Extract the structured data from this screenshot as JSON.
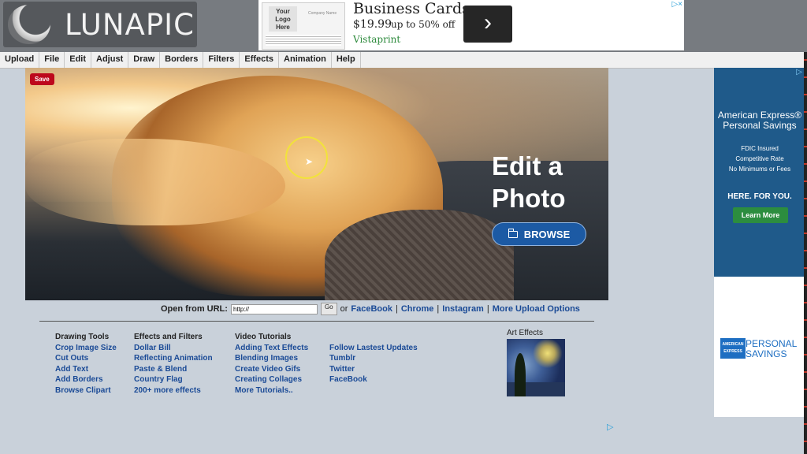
{
  "logo": {
    "text": "LUNAPIC"
  },
  "top_ad": {
    "card_logo": "Your Logo Here",
    "card_name": "Company Name",
    "headline": "Business Cards",
    "price": "$19.99",
    "offer": "up to 50% off",
    "brand": "Vistaprint",
    "arrow": "›",
    "choice_icon": "▷×"
  },
  "menu": [
    "Upload",
    "File",
    "Edit",
    "Adjust",
    "Draw",
    "Borders",
    "Filters",
    "Effects",
    "Animation",
    "Help"
  ],
  "hero": {
    "save_label": "Save",
    "title_line1": "Edit a",
    "title_line2": "Photo",
    "browse_label": "BROWSE"
  },
  "url_row": {
    "label": "Open from URL:",
    "input_value": "http://",
    "go": "Go",
    "or_text": "or",
    "sep": "|",
    "links": [
      "FaceBook",
      "Chrome",
      "Instagram",
      "More Upload Options"
    ]
  },
  "columns": {
    "col1": {
      "heading": "Drawing Tools",
      "links": [
        "Crop Image Size",
        "Cut Outs",
        "Add Text",
        "Add Borders",
        "Browse Clipart"
      ]
    },
    "col2": {
      "heading": "Effects and Filters",
      "links": [
        "Dollar Bill",
        "Reflecting Animation",
        "Paste & Blend",
        "Country Flag",
        "200+ more effects"
      ]
    },
    "col3": {
      "heading": "Video Tutorials",
      "links": [
        "Adding Text Effects",
        "Blending Images",
        "Create Video Gifs",
        "Creating Collages",
        "More Tutorials.."
      ]
    },
    "col4": {
      "links": [
        "Follow Lastest Updates",
        "Tumblr",
        "Twitter",
        "FaceBook"
      ]
    }
  },
  "art_effects": {
    "label": "Art Effects"
  },
  "side_ad1": {
    "headline_line1": "American Express®",
    "headline_line2": "Personal Savings",
    "features": [
      "FDIC Insured",
      "Competitive Rate",
      "No Minimums or Fees"
    ],
    "tagline": "HERE. FOR YOU.",
    "cta": "Learn More",
    "choice_icon": "▷"
  },
  "side_ad2": {
    "logo_text": "AMERICAN EXPRESS",
    "line1": "PERSONAL",
    "line2": "SAVINGS"
  },
  "bottom_ad_choice": "▷"
}
